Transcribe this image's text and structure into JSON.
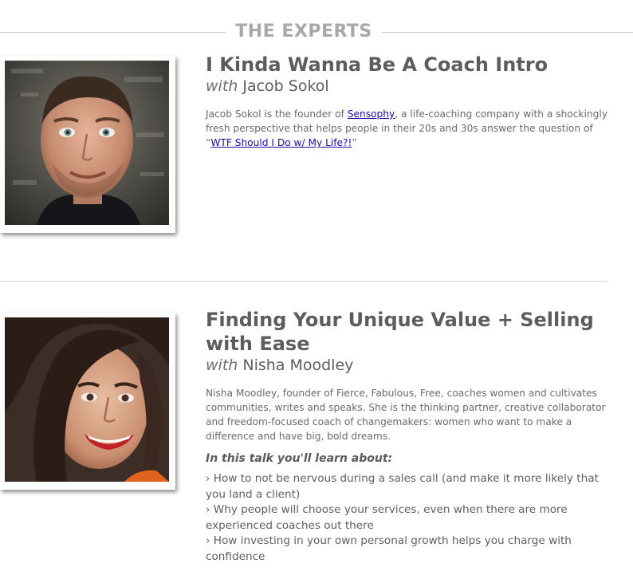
{
  "section": {
    "title": "THE EXPERTS"
  },
  "experts": [
    {
      "talk_title": "I Kinda Wanna Be A Coach Intro",
      "with_word": "with",
      "name": "Jacob Sokol",
      "bio_prefix": "Jacob Sokol is the founder of ",
      "bio_link": "Sensophy",
      "bio_middle": ", a life-coaching company with a shockingly fresh perspective that helps people in their 20s and 30s answer the question of “",
      "bio_link2": "WTF Should I Do w/ My Life?!",
      "bio_suffix": "”"
    },
    {
      "talk_title": "Finding Your Unique Value + Selling with Ease",
      "with_word": "with",
      "name": "Nisha Moodley",
      "bio": "Nisha Moodley, founder of Fierce, Fabulous, Free, coaches women and cultivates communities, writes and speaks. She is the thinking partner, creative collaborator and freedom-focused coach of changemakers: women who want to make a difference and have big, bold dreams.",
      "learn_heading": "In this talk you'll learn about:",
      "bullets": [
        "› How to not be nervous during a sales call (and make it more likely that you land a client)",
        "› Why people will choose your services, even when there are more experienced coaches out there",
        "› How investing in your own personal growth helps you charge with confidence"
      ]
    }
  ],
  "colors": {
    "heading": "#a8a8a8",
    "text": "#5f5f5f",
    "link": "#1a0dab",
    "rule": "#c8c8c8"
  }
}
